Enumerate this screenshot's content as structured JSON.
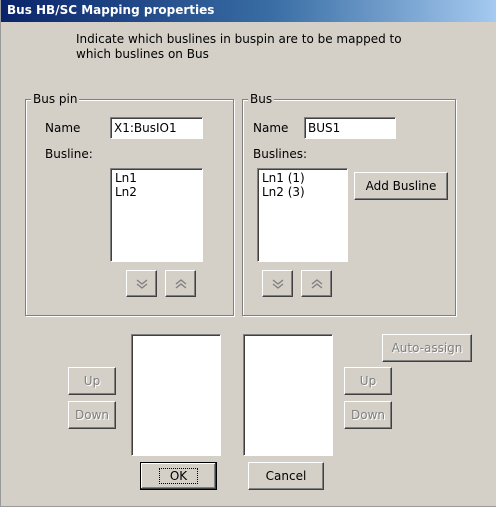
{
  "window": {
    "title": "Bus HB/SC Mapping properties"
  },
  "instructions": "Indicate which buslines in buspin are to be mapped to which buslines on Bus",
  "bus_pin": {
    "group_label": "Bus pin",
    "name_label": "Name",
    "name_value": "X1:BusIO1",
    "busline_label": "Busline:",
    "buslines": [
      "Ln1",
      "Ln2"
    ]
  },
  "bus": {
    "group_label": "Bus",
    "name_label": "Name",
    "name_value": "BUS1",
    "buslines_label": "Buslines:",
    "buslines": [
      "Ln1 (1)",
      "Ln2 (3)"
    ],
    "add_busline_label": "Add Busline"
  },
  "mapping": {
    "left_up_label": "Up",
    "left_down_label": "Down",
    "right_up_label": "Up",
    "right_down_label": "Down",
    "auto_assign_label": "Auto-assign"
  },
  "footer": {
    "ok_label": "OK",
    "cancel_label": "Cancel"
  }
}
